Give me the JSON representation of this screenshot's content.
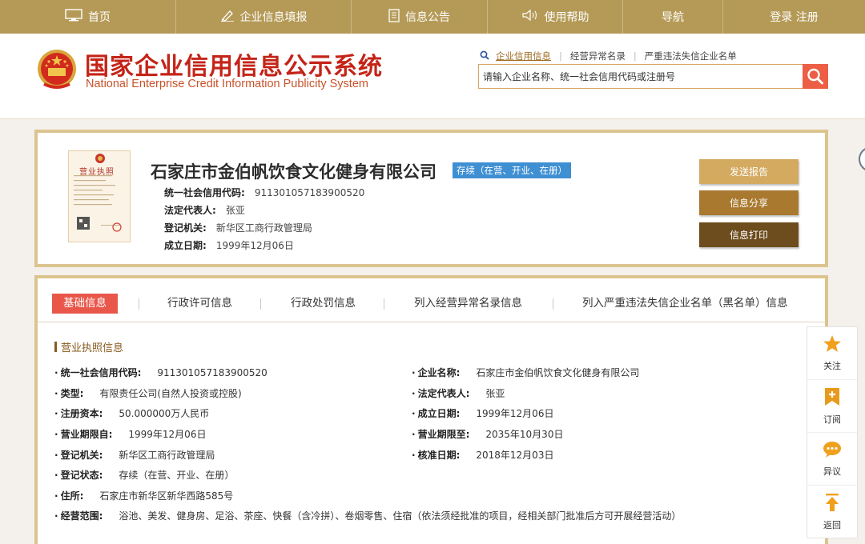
{
  "nav": {
    "home": "首页",
    "fill_info": "企业信息填报",
    "announcement": "信息公告",
    "help": "使用帮助",
    "navigation": "导航",
    "login_register": "登录 注册"
  },
  "header": {
    "title_cn": "国家企业信用信息公示系统",
    "title_en": "National Enterprise Credit Information Publicity System",
    "search_tabs": [
      "企业信用信息",
      "经营异常名录",
      "严重违法失信企业名单"
    ],
    "search_placeholder": "请输入企业名称、统一社会信用代码或注册号"
  },
  "company": {
    "name": "石家庄市金伯帆饮食文化健身有限公司",
    "status": "存续（在营、开业、在册）",
    "license_label": "营业执照",
    "fields": [
      {
        "label": "统一社会信用代码:",
        "value": "911301057183900520"
      },
      {
        "label": "法定代表人:",
        "value": "张亚"
      },
      {
        "label": "登记机关:",
        "value": "新华区工商行政管理局"
      },
      {
        "label": "成立日期:",
        "value": "1999年12月06日"
      }
    ],
    "buttons": {
      "report": "发送报告",
      "share": "信息分享",
      "print": "信息打印"
    }
  },
  "tabs": [
    "基础信息",
    "行政许可信息",
    "行政处罚信息",
    "列入经营异常名录信息",
    "列入严重违法失信企业名单（黑名单）信息"
  ],
  "business_license": {
    "section_title": "营业执照信息",
    "credit_code": {
      "label": "统一社会信用代码:",
      "value": "911301057183900520"
    },
    "company_name": {
      "label": "企业名称:",
      "value": "石家庄市金伯帆饮食文化健身有限公司"
    },
    "type": {
      "label": "类型:",
      "value": "有限责任公司(自然人投资或控股)"
    },
    "legal_rep": {
      "label": "法定代表人:",
      "value": "张亚"
    },
    "capital": {
      "label": "注册资本:",
      "value": "50.000000万人民币"
    },
    "founded": {
      "label": "成立日期:",
      "value": "1999年12月06日"
    },
    "term_from": {
      "label": "营业期限自:",
      "value": "1999年12月06日"
    },
    "term_to": {
      "label": "营业期限至:",
      "value": "2035年10月30日"
    },
    "authority": {
      "label": "登记机关:",
      "value": "新华区工商行政管理局"
    },
    "approval_date": {
      "label": "核准日期:",
      "value": "2018年12月03日"
    },
    "reg_status": {
      "label": "登记状态:",
      "value": "存续（在营、开业、在册）"
    },
    "address": {
      "label": "住所:",
      "value": "石家庄市新华区新华西路585号"
    },
    "scope": {
      "label": "经营范围:",
      "value": "浴池、美发、健身房、足浴、茶座、快餐（含冷拼）、卷烟零售、住宿（依法须经批准的项目，经相关部门批准后方可开展经营活动）"
    }
  },
  "float_bar": {
    "follow": "关注",
    "subscribe": "订阅",
    "objection": "异议",
    "back": "返回"
  },
  "colors": {
    "nav_bg": "#b59a57",
    "title_red": "#c42418",
    "status_blue": "#3f8fd3",
    "tab_active": "#e9574a",
    "border_gold": "#dcc48e"
  }
}
